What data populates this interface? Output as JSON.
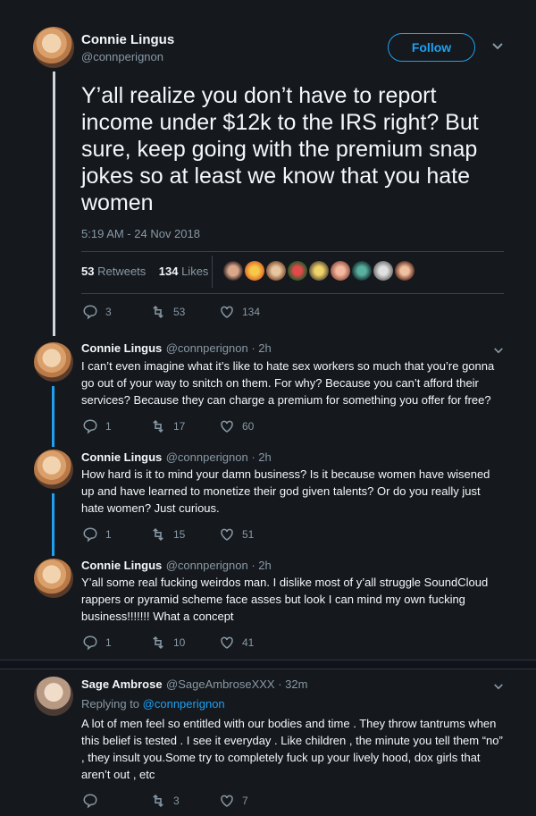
{
  "main_tweet": {
    "author_name": "Connie Lingus",
    "author_handle": "@connperignon",
    "follow_label": "Follow",
    "text": "Y’all realize you don’t have to report income under $12k to the IRS right? But sure, keep going with the premium snap jokes so at least we know that you hate women",
    "timestamp": "5:19 AM - 24 Nov 2018",
    "retweets_count": "53",
    "retweets_label": "Retweets",
    "likes_count": "134",
    "likes_label": "Likes",
    "actions": {
      "reply": "3",
      "retweet": "53",
      "like": "134"
    }
  },
  "replies": [
    {
      "author_name": "Connie Lingus",
      "author_handle": "@connperignon · 2h",
      "text": "I can’t even imagine what it’s like to hate sex workers so much that you’re gonna go out of your way to snitch on them. For why? Because you can’t afford their services? Because they can charge a premium for something you offer for free?",
      "reply": "1",
      "retweet": "17",
      "like": "60"
    },
    {
      "author_name": "Connie Lingus",
      "author_handle": "@connperignon · 2h",
      "text": "How hard is it to mind your damn business? Is it because women have wisened up and have learned to monetize their god given talents? Or do you really just hate women? Just curious.",
      "reply": "1",
      "retweet": "15",
      "like": "51"
    },
    {
      "author_name": "Connie Lingus",
      "author_handle": "@connperignon · 2h",
      "text": "Y’all some real fucking weirdos man. I dislike most of y’all struggle SoundCloud rappers or pyramid scheme face asses but look I can mind my own fucking business!!!!!!! What a concept",
      "reply": "1",
      "retweet": "10",
      "like": "41"
    }
  ],
  "other_reply": {
    "author_name": "Sage Ambrose",
    "author_handle": "@SageAmbroseXXX · 32m",
    "replying_label": "Replying to",
    "replying_to": "@connperignon",
    "text": "A lot of men feel so entitled with our bodies and time . They throw tantrums when this belief is tested . I see it everyday . Like children , the minute you tell them “no” , they insult you.Some try to completely fuck up your lively hood, dox girls that aren’t out , etc",
    "reply": "",
    "retweet": "3",
    "like": "7"
  },
  "colors": {
    "background": "#15181c",
    "accent": "#1da1f2",
    "muted": "#8899a6"
  }
}
